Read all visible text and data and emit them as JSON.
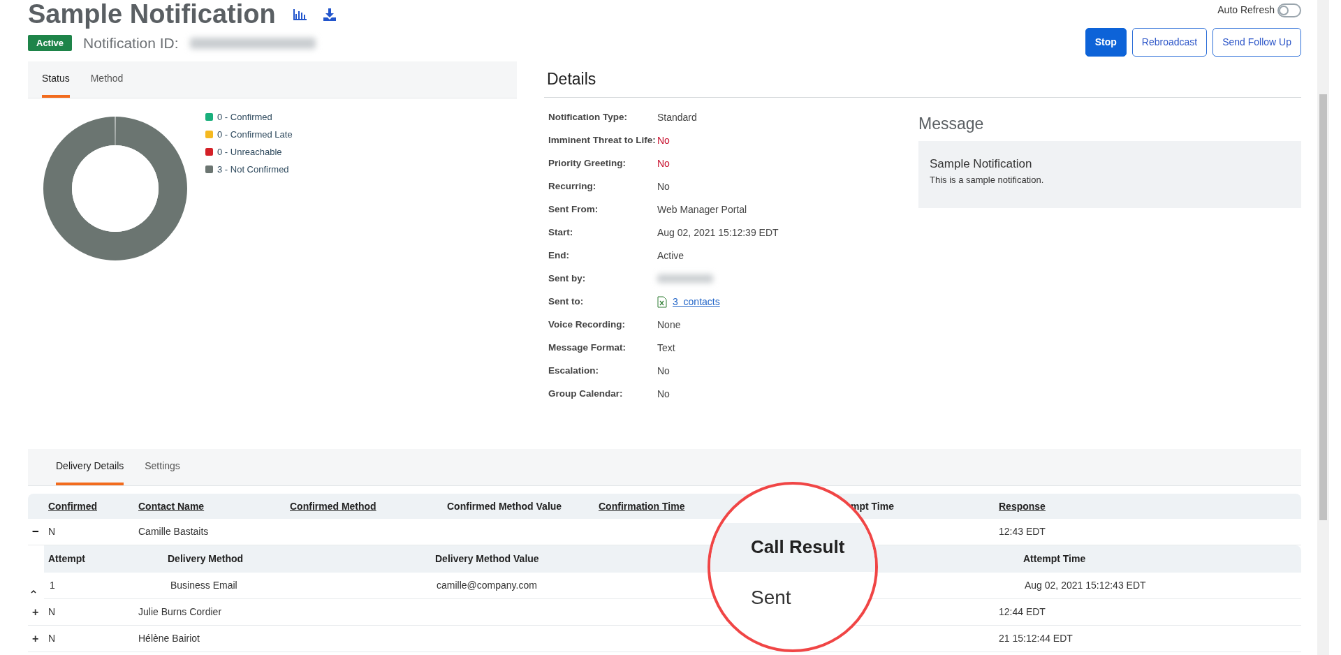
{
  "header": {
    "title": "Sample Notification",
    "status_badge": "Active",
    "id_label": "Notification ID:",
    "auto_refresh": {
      "label": "Auto Refresh",
      "on": false
    },
    "buttons": [
      {
        "label": "Stop",
        "kind": "primary"
      },
      {
        "label": "Rebroadcast",
        "kind": "outline"
      },
      {
        "label": "Send Follow Up",
        "kind": "outline"
      }
    ]
  },
  "status_panel": {
    "tabs": [
      {
        "label": "Status",
        "selected": true
      },
      {
        "label": "Method",
        "selected": false
      }
    ],
    "legend": [
      {
        "label": "0 - Confirmed",
        "color": "#1aaf7c"
      },
      {
        "label": "0 - Confirmed Late",
        "color": "#f5b921"
      },
      {
        "label": "0 - Unreachable",
        "color": "#d42027"
      },
      {
        "label": "3 - Not Confirmed",
        "color": "#6b7571"
      }
    ],
    "chart_data": {
      "type": "donut",
      "values": [
        0,
        0,
        0,
        100
      ]
    }
  },
  "details": {
    "title": "Details",
    "rows": [
      {
        "label": "Notification Type:",
        "value": "Standard",
        "kind": "text"
      },
      {
        "label": "Imminent Threat to Life:",
        "value": "No",
        "kind": "alert"
      },
      {
        "label": "Priority Greeting:",
        "value": "No",
        "kind": "alert"
      },
      {
        "label": "Recurring:",
        "value": "No",
        "kind": "text"
      },
      {
        "label": "Sent From:",
        "value": "Web Manager Portal",
        "kind": "text"
      },
      {
        "label": "Start:",
        "value": "Aug 02, 2021 15:12:39 EDT",
        "kind": "text"
      },
      {
        "label": "End:",
        "value": "Active",
        "kind": "text"
      },
      {
        "label": "Sent by:",
        "kind": "blurred"
      },
      {
        "label": "Sent to:",
        "value": "3  contacts",
        "kind": "link"
      },
      {
        "label": "Voice Recording:",
        "value": "None",
        "kind": "text"
      },
      {
        "label": "Message Format:",
        "value": "Text",
        "kind": "text"
      },
      {
        "label": "Escalation:",
        "value": "No",
        "kind": "text"
      },
      {
        "label": "Group Calendar:",
        "value": "No",
        "kind": "text"
      }
    ]
  },
  "message": {
    "title": "Message",
    "subject": "Sample Notification",
    "body": "This is a sample notification."
  },
  "delivery": {
    "tabs": [
      {
        "label": "Delivery Details",
        "selected": true
      },
      {
        "label": "Settings",
        "selected": false
      }
    ],
    "columns": [
      {
        "label": "Confirmed",
        "sortable": true
      },
      {
        "label": "Contact Name",
        "sortable": true
      },
      {
        "label": "Confirmed Method",
        "sortable": true
      },
      {
        "label": "Confirmed Method Value",
        "sortable": false
      },
      {
        "label": "Confirmation Time",
        "sortable": true
      },
      {
        "label": "mpt Time",
        "sortable": false
      },
      {
        "label": "Response",
        "sortable": true
      }
    ],
    "rows": [
      {
        "toggle": "−",
        "expanded": true,
        "confirmed": "N",
        "name": "Camille Bastaits",
        "time": "12:43 EDT",
        "attempts": {
          "columns": [
            "Attempt",
            "Delivery Method",
            "Delivery Method Value",
            "Attempt Time"
          ],
          "rows": [
            [
              "1",
              "Business Email",
              "camille@company.com",
              "Aug 02, 2021 15:12:43 EDT"
            ]
          ]
        }
      },
      {
        "toggle": "+",
        "expanded": false,
        "confirmed": "N",
        "name": "Julie Burns Cordier",
        "time": "12:44 EDT"
      },
      {
        "toggle": "+",
        "expanded": false,
        "confirmed": "N",
        "name": "Hélène Bairiot",
        "time": "21 15:12:44 EDT"
      }
    ]
  },
  "magnifier": {
    "header": "Call Result",
    "value": "Sent"
  }
}
